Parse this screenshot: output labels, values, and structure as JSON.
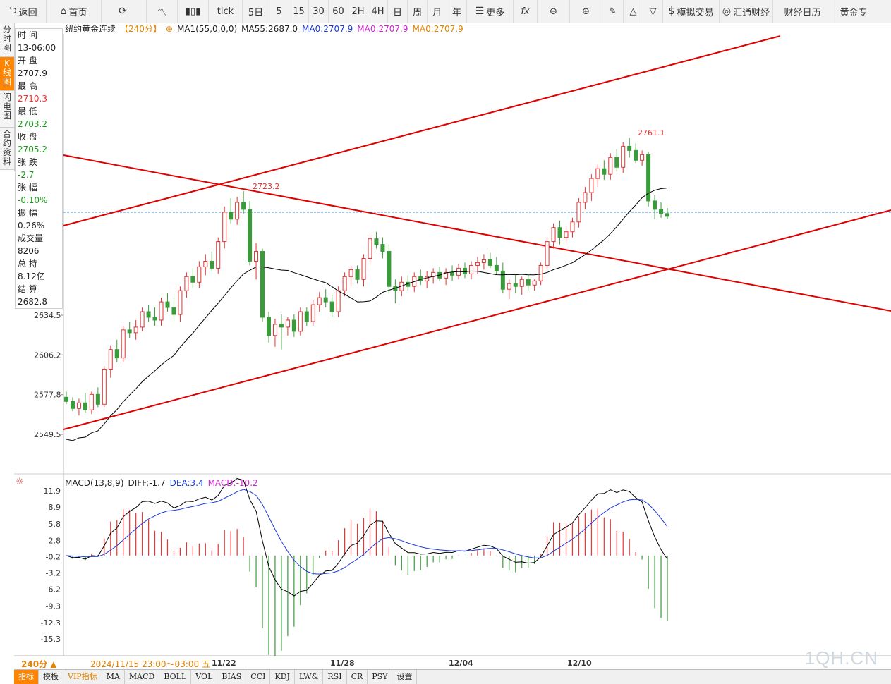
{
  "toolbar": {
    "back": "返回",
    "home": "首页",
    "tick": "tick",
    "5day": "5日",
    "periods": [
      "5",
      "15",
      "30",
      "60",
      "2H",
      "4H",
      "日",
      "周",
      "月",
      "年"
    ],
    "more": "更多",
    "sim_trade": "模拟交易",
    "huitong": "汇通财经",
    "calendar": "财经日历",
    "gold": "黄金专"
  },
  "left_tabs": [
    "分时图",
    "K线图",
    "闪电图",
    "合约资料"
  ],
  "info": {
    "time_label": "时 间",
    "time": "13-06:00",
    "open_label": "开 盘",
    "open": "2707.9",
    "high_label": "最 高",
    "high": "2710.3",
    "low_label": "最 低",
    "low": "2703.2",
    "close_label": "收 盘",
    "close": "2705.2",
    "chg_label": "张 跌",
    "chg": "-2.7",
    "pct_label": "张 幅",
    "pct": "-0.10%",
    "amp_label": "振 幅",
    "amp": "0.26%",
    "vol_label": "成交量",
    "vol": "8206",
    "oi_label": "总 持",
    "oi": "8.12亿",
    "settle_label": "结 算",
    "settle": "2682.8"
  },
  "header": {
    "name": "纽约黄金连续",
    "period": "【240分】",
    "ma1": "MA1(55,0,0,0)",
    "ma55": "MA55:2687.0",
    "ma0a": "MA0:2707.9",
    "ma0b": "MA0:2707.9",
    "ma0c": "MA0:2707.9"
  },
  "macd_header": {
    "name": "MACD(13,8,9)",
    "diff": "DIFF:-1.7",
    "dea": "DEA:3.4",
    "macd": "MACD:-10.2"
  },
  "price_ticks": [
    "2634.5",
    "2606.2",
    "2577.8",
    "2549.5"
  ],
  "macd_ticks": [
    "11.9",
    "8.9",
    "5.8",
    "2.8",
    "-0.2",
    "-3.2",
    "-6.2",
    "-9.3",
    "-12.3",
    "-15.3"
  ],
  "date_labels": [
    "11/22",
    "11/28",
    "12/04",
    "12/10"
  ],
  "bottom": {
    "period": "240分 ▲",
    "datetime": "2024/11/15 23:00～03:00 五"
  },
  "annotations": {
    "high1": "2723.2",
    "high2": "2761.1"
  },
  "indicator_tabs": [
    "指标",
    "模板",
    "VIP指标",
    "MA",
    "MACD",
    "BOLL",
    "VOL",
    "BIAS",
    "CCI",
    "KDJ",
    "LW&",
    "RSI",
    "CR",
    "PSY",
    "设置"
  ],
  "watermark": "1QH.CN",
  "chart_data": {
    "type": "candlestick",
    "price_axis_ticks": [
      2634.5,
      2606.2,
      2577.8,
      2549.5
    ],
    "annotated_highs": [
      2723.2,
      2761.1
    ],
    "last_close": 2705.2,
    "colors": {
      "up": "#e33333",
      "down": "#3a9b3a",
      "trendline": "#e00000",
      "ma": "#000000"
    },
    "candles": [
      [
        2576,
        2580,
        2571,
        2573
      ],
      [
        2573,
        2576,
        2566,
        2568
      ],
      [
        2568,
        2575,
        2563,
        2572
      ],
      [
        2572,
        2579,
        2565,
        2567
      ],
      [
        2567,
        2580,
        2564,
        2578
      ],
      [
        2578,
        2583,
        2569,
        2571
      ],
      [
        2571,
        2598,
        2569,
        2596
      ],
      [
        2596,
        2613,
        2590,
        2610
      ],
      [
        2610,
        2617,
        2601,
        2604
      ],
      [
        2604,
        2627,
        2601,
        2624
      ],
      [
        2624,
        2630,
        2618,
        2622
      ],
      [
        2622,
        2631,
        2617,
        2626
      ],
      [
        2626,
        2640,
        2623,
        2637
      ],
      [
        2637,
        2642,
        2630,
        2633
      ],
      [
        2633,
        2640,
        2627,
        2631
      ],
      [
        2631,
        2647,
        2627,
        2644
      ],
      [
        2644,
        2650,
        2637,
        2640
      ],
      [
        2640,
        2648,
        2632,
        2635
      ],
      [
        2635,
        2655,
        2630,
        2652
      ],
      [
        2652,
        2665,
        2647,
        2662
      ],
      [
        2662,
        2668,
        2654,
        2658
      ],
      [
        2658,
        2673,
        2654,
        2669
      ],
      [
        2669,
        2678,
        2663,
        2673
      ],
      [
        2673,
        2680,
        2666,
        2668
      ],
      [
        2668,
        2690,
        2664,
        2687
      ],
      [
        2687,
        2712,
        2682,
        2708
      ],
      [
        2708,
        2718,
        2700,
        2703
      ],
      [
        2703,
        2719,
        2699,
        2715
      ],
      [
        2715,
        2723,
        2707,
        2710
      ],
      [
        2710,
        2716,
        2670,
        2673
      ],
      [
        2673,
        2686,
        2660,
        2680
      ],
      [
        2680,
        2682,
        2630,
        2633
      ],
      [
        2633,
        2637,
        2615,
        2620
      ],
      [
        2620,
        2632,
        2612,
        2628
      ],
      [
        2628,
        2635,
        2610,
        2626
      ],
      [
        2626,
        2633,
        2620,
        2631
      ],
      [
        2631,
        2635,
        2619,
        2623
      ],
      [
        2623,
        2640,
        2620,
        2637
      ],
      [
        2637,
        2640,
        2627,
        2630
      ],
      [
        2630,
        2645,
        2627,
        2642
      ],
      [
        2642,
        2651,
        2637,
        2647
      ],
      [
        2647,
        2653,
        2640,
        2644
      ],
      [
        2644,
        2649,
        2633,
        2637
      ],
      [
        2637,
        2655,
        2633,
        2652
      ],
      [
        2652,
        2665,
        2648,
        2662
      ],
      [
        2662,
        2670,
        2655,
        2667
      ],
      [
        2667,
        2670,
        2657,
        2660
      ],
      [
        2660,
        2678,
        2655,
        2675
      ],
      [
        2675,
        2692,
        2671,
        2689
      ],
      [
        2689,
        2694,
        2682,
        2685
      ],
      [
        2685,
        2690,
        2675,
        2680
      ],
      [
        2680,
        2685,
        2650,
        2655
      ],
      [
        2655,
        2660,
        2643,
        2652
      ],
      [
        2652,
        2662,
        2648,
        2658
      ],
      [
        2658,
        2663,
        2652,
        2655
      ],
      [
        2655,
        2665,
        2651,
        2662
      ],
      [
        2662,
        2667,
        2656,
        2659
      ],
      [
        2659,
        2666,
        2654,
        2662
      ],
      [
        2662,
        2668,
        2657,
        2665
      ],
      [
        2665,
        2669,
        2659,
        2661
      ],
      [
        2661,
        2668,
        2656,
        2665
      ],
      [
        2665,
        2670,
        2659,
        2663
      ],
      [
        2663,
        2671,
        2660,
        2668
      ],
      [
        2668,
        2672,
        2661,
        2664
      ],
      [
        2664,
        2673,
        2660,
        2670
      ],
      [
        2670,
        2676,
        2664,
        2672
      ],
      [
        2672,
        2678,
        2667,
        2674
      ],
      [
        2674,
        2679,
        2668,
        2670
      ],
      [
        2670,
        2676,
        2664,
        2666
      ],
      [
        2666,
        2672,
        2650,
        2653
      ],
      [
        2653,
        2660,
        2646,
        2657
      ],
      [
        2657,
        2663,
        2650,
        2655
      ],
      [
        2655,
        2662,
        2649,
        2660
      ],
      [
        2660,
        2664,
        2652,
        2656
      ],
      [
        2656,
        2660,
        2652,
        2659
      ],
      [
        2659,
        2672,
        2656,
        2670
      ],
      [
        2670,
        2690,
        2667,
        2687
      ],
      [
        2687,
        2700,
        2682,
        2697
      ],
      [
        2697,
        2702,
        2685,
        2690
      ],
      [
        2690,
        2698,
        2686,
        2694
      ],
      [
        2694,
        2704,
        2690,
        2701
      ],
      [
        2701,
        2718,
        2697,
        2715
      ],
      [
        2715,
        2726,
        2710,
        2722
      ],
      [
        2722,
        2735,
        2716,
        2732
      ],
      [
        2732,
        2742,
        2726,
        2739
      ],
      [
        2739,
        2745,
        2731,
        2735
      ],
      [
        2735,
        2750,
        2731,
        2747
      ],
      [
        2747,
        2753,
        2737,
        2740
      ],
      [
        2740,
        2758,
        2736,
        2755
      ],
      [
        2755,
        2761,
        2747,
        2752
      ],
      [
        2752,
        2757,
        2743,
        2745
      ],
      [
        2745,
        2752,
        2741,
        2749
      ],
      [
        2749,
        2751,
        2712,
        2716
      ],
      [
        2716,
        2720,
        2703,
        2710
      ],
      [
        2710,
        2715,
        2704,
        2707
      ],
      [
        2707,
        2711,
        2703,
        2705
      ]
    ]
  }
}
